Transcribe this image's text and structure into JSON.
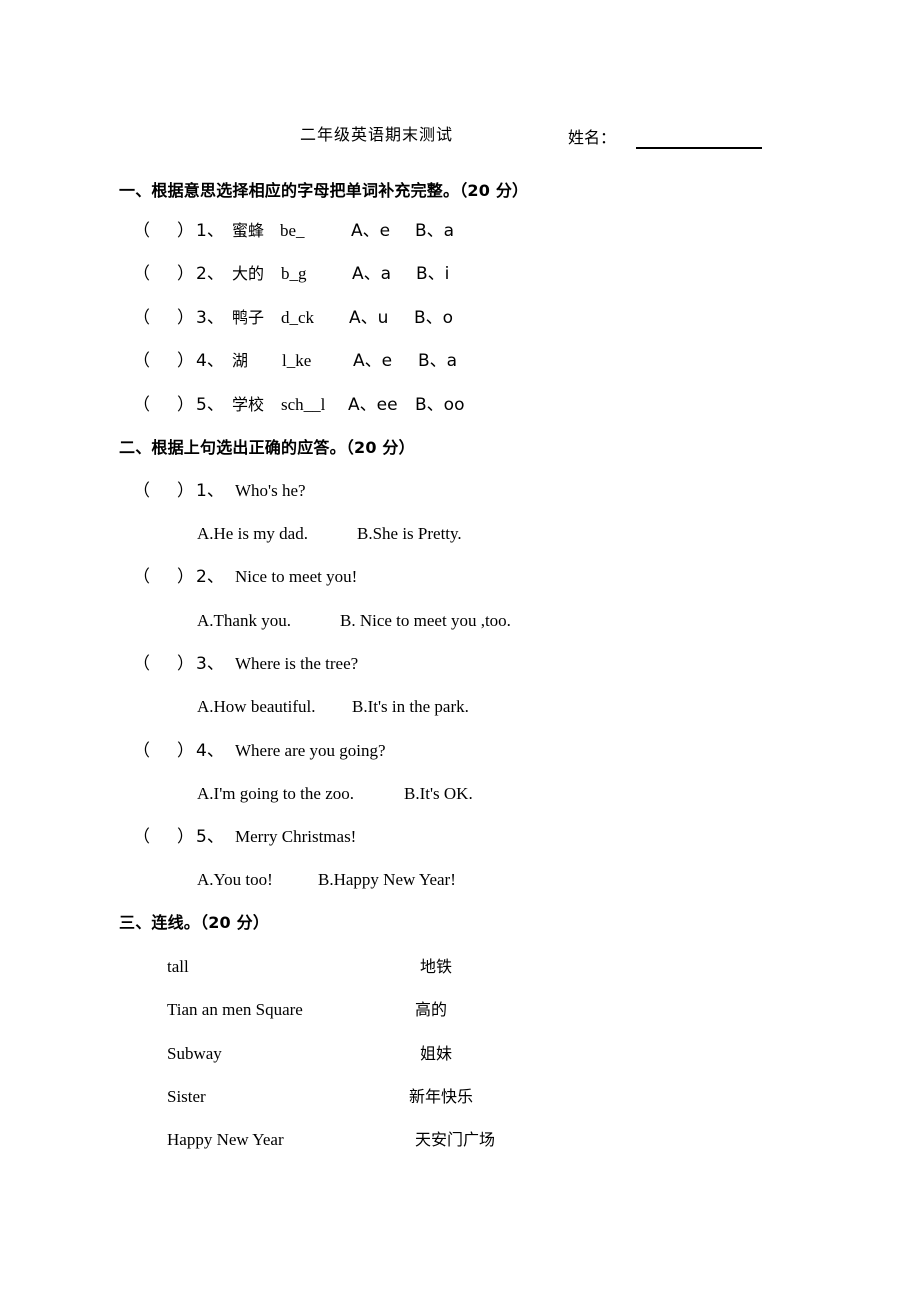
{
  "document": {
    "title": "二年级英语期末测试",
    "name_label": "姓名：",
    "name_value": ""
  },
  "sections": [
    {
      "heading": "一、根据意思选择相应的字母把单词补充完整。（20 分）",
      "type": "fill-letter",
      "items": [
        {
          "paren_open": "（",
          "paren_close": "）",
          "num": "1、",
          "meaning": "蜜蜂",
          "word": "be_",
          "optA": "A、e",
          "optB": "B、a"
        },
        {
          "paren_open": "（",
          "paren_close": "）",
          "num": "2、",
          "meaning": "大的",
          "word": "b_g",
          "optA": "A、a",
          "optB": "B、i"
        },
        {
          "paren_open": "（",
          "paren_close": "）",
          "num": "3、",
          "meaning": "鸭子",
          "word": "d_ck",
          "optA": "A、u",
          "optB": "B、o"
        },
        {
          "paren_open": "（",
          "paren_close": "）",
          "num": "4、",
          "meaning": "湖",
          "word": "l_ke",
          "optA": "A、e",
          "optB": "B、a"
        },
        {
          "paren_open": "（",
          "paren_close": "）",
          "num": "5、",
          "meaning": "学校",
          "word": "sch__l",
          "optA": "A、ee",
          "optB": "B、oo"
        }
      ]
    },
    {
      "heading": "二、根据上句选出正确的应答。（20 分）",
      "type": "multiple-choice",
      "items": [
        {
          "paren_open": "（",
          "paren_close": "）",
          "num": "1、",
          "prompt": "Who's he?",
          "optA": "A.He is my dad.",
          "optB": "B.She is Pretty."
        },
        {
          "paren_open": "（",
          "paren_close": "）",
          "num": "2、",
          "prompt": "Nice to meet you!",
          "optA": "A.Thank you.",
          "optB": "B. Nice to meet you ,too."
        },
        {
          "paren_open": "（",
          "paren_close": "）",
          "num": "3、",
          "prompt": "Where is the tree?",
          "optA": "A.How beautiful.",
          "optB": "B.It's in the park."
        },
        {
          "paren_open": "（",
          "paren_close": "）",
          "num": "4、",
          "prompt": "Where are you going?",
          "optA": "A.I'm going to the zoo.",
          "optB": "B.It's OK."
        },
        {
          "paren_open": "（",
          "paren_close": "）",
          "num": "5、",
          "prompt": "Merry Christmas!",
          "optA": "A.You too!",
          "optB": "B.Happy New Year!"
        }
      ]
    },
    {
      "heading": "三、连线。（20 分）",
      "type": "matching",
      "pairs": [
        {
          "left": "tall",
          "right": "地铁"
        },
        {
          "left": "Tian an men Square",
          "right": "高的"
        },
        {
          "left": "Subway",
          "right": "姐妹"
        },
        {
          "left": "Sister",
          "right": "新年快乐"
        },
        {
          "left": "Happy New Year",
          "right": "天安门广场"
        }
      ]
    }
  ]
}
